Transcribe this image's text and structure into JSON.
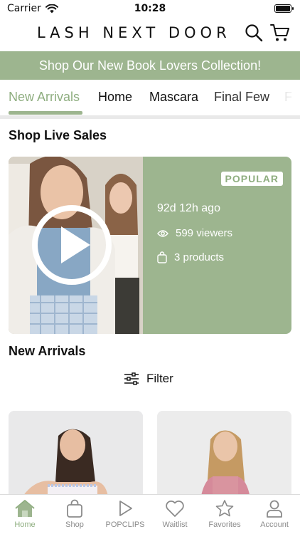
{
  "status_bar": {
    "carrier": "Carrier",
    "time": "10:28"
  },
  "header": {
    "brand": "LASH NEXT DOOR",
    "icons": [
      "search-icon",
      "cart-icon"
    ]
  },
  "promo": {
    "text": "Shop Our New Book Lovers Collection!"
  },
  "category_tabs": [
    {
      "label": "New Arrivals",
      "active": true
    },
    {
      "label": "Home"
    },
    {
      "label": "Mascara"
    },
    {
      "label": "Final Few"
    },
    {
      "label": "F"
    }
  ],
  "live_sales": {
    "title": "Shop Live Sales",
    "badge": "POPULAR",
    "time_ago": "92d 12h ago",
    "viewers": "599 viewers",
    "products": "3 products"
  },
  "new_arrivals": {
    "title": "New Arrivals",
    "filter_label": "Filter"
  },
  "bottom_nav": [
    {
      "label": "Home",
      "icon": "home-icon",
      "active": true
    },
    {
      "label": "Shop",
      "icon": "bag-icon"
    },
    {
      "label": "POPCLIPS",
      "icon": "play-icon"
    },
    {
      "label": "Waitlist",
      "icon": "heart-icon"
    },
    {
      "label": "Favorites",
      "icon": "star-icon"
    },
    {
      "label": "Account",
      "icon": "person-icon"
    }
  ],
  "colors": {
    "accent": "#9db58f",
    "accent_text": "#8fae80",
    "text": "#111111",
    "muted": "#8a8a8a"
  }
}
